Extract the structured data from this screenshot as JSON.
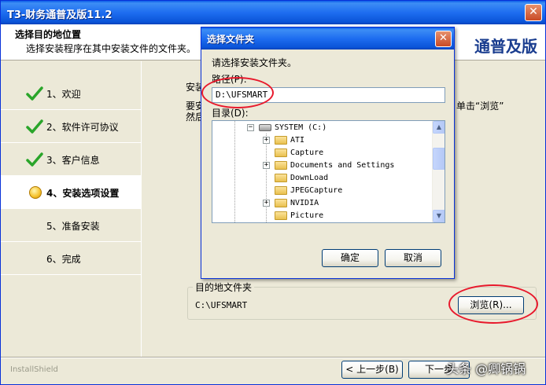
{
  "window": {
    "title": "T3-财务通普及版11.2",
    "close_glyph": "✕",
    "brand": "通普及版"
  },
  "header": {
    "title": "选择目的地位置",
    "subtitle": "选择安装程序在其中安装文件的文件夹。"
  },
  "steps": [
    {
      "label": "1、欢迎",
      "state": "done"
    },
    {
      "label": "2、软件许可协议",
      "state": "done"
    },
    {
      "label": "3、客户信息",
      "state": "done"
    },
    {
      "label": "4、安装选项设置",
      "state": "active"
    },
    {
      "label": "5、准备安装",
      "state": "pending"
    },
    {
      "label": "6、完成",
      "state": "pending"
    }
  ],
  "content": {
    "text_line1": "安装",
    "text_line2": "要安",
    "text_line2_end": "单击“浏览”",
    "text_line3": "然后",
    "dest_group_label": "目的地文件夹",
    "dest_path": "C:\\UFSMART",
    "browse_label": "浏览(R)..."
  },
  "nav": {
    "back_label": "< 上一步(B)",
    "next_label": "下一步"
  },
  "footer": {
    "installshield": "InstallShield",
    "watermark": "头条 @卿锅锅"
  },
  "dialog": {
    "title": "选择文件夹",
    "close_glyph": "✕",
    "prompt": "请选择安装文件夹。",
    "path_label": "路径(P):",
    "path_value": "D:\\UFSMART",
    "dir_label": "目录(D):",
    "tree": [
      {
        "label": "SYSTEM (C:)",
        "kind": "drive",
        "expander": "−"
      },
      {
        "label": "ATI",
        "kind": "folder",
        "expander": "+"
      },
      {
        "label": "Capture",
        "kind": "folder",
        "expander": ""
      },
      {
        "label": "Documents and Settings",
        "kind": "folder",
        "expander": "+"
      },
      {
        "label": "DownLoad",
        "kind": "folder",
        "expander": ""
      },
      {
        "label": "JPEGCapture",
        "kind": "folder",
        "expander": ""
      },
      {
        "label": "NVIDIA",
        "kind": "folder",
        "expander": "+"
      },
      {
        "label": "Picture",
        "kind": "folder",
        "expander": ""
      }
    ],
    "ok_label": "确定",
    "cancel_label": "取消"
  },
  "colors": {
    "titlebar_blue": "#0a54d8",
    "annotation_red": "#e8192c",
    "check_green": "#2aa52a"
  },
  "icons": {
    "done": "check-icon",
    "active": "bulb-icon",
    "scroll_up": "▲",
    "scroll_down": "▼"
  }
}
